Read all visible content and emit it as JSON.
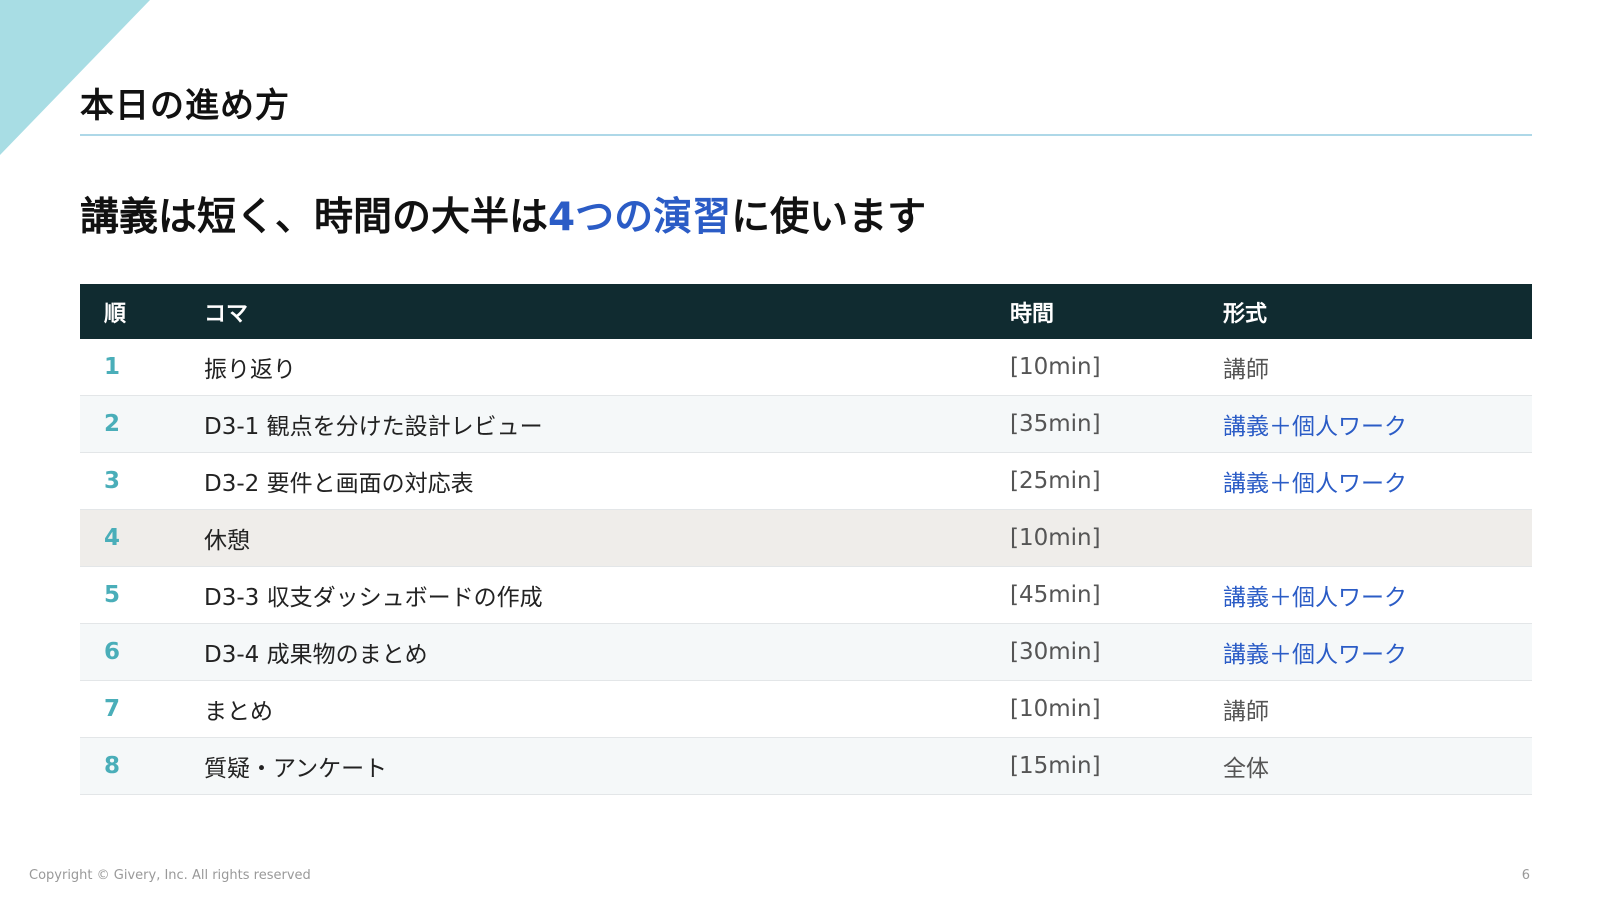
{
  "page": {
    "title": "本日の進め方",
    "headline_pre": "講義は短く、時間の大半は",
    "headline_highlight": "4つの演習",
    "headline_post": "に使います"
  },
  "table": {
    "headers": {
      "order": "順",
      "title": "コマ",
      "time": "時間",
      "format": "形式"
    },
    "rows": [
      {
        "order": "1",
        "title": "振り返り",
        "time": "[10min]",
        "format": "講師"
      },
      {
        "order": "2",
        "title": "D3-1 観点を分けた設計レビュー",
        "time": "[35min]",
        "format": "講義＋個人ワーク"
      },
      {
        "order": "3",
        "title": "D3-2 要件と画面の対応表",
        "time": "[25min]",
        "format": "講義＋個人ワーク"
      },
      {
        "order": "4",
        "title": "休憩",
        "time": "[10min]",
        "format": ""
      },
      {
        "order": "5",
        "title": "D3-3 収支ダッシュボードの作成",
        "time": "[45min]",
        "format": "講義＋個人ワーク"
      },
      {
        "order": "6",
        "title": "D3-4 成果物のまとめ",
        "time": "[30min]",
        "format": "講義＋個人ワーク"
      },
      {
        "order": "7",
        "title": "まとめ",
        "time": "[10min]",
        "format": "講師"
      },
      {
        "order": "8",
        "title": "質疑・アンケート",
        "time": "[15min]",
        "format": "全体"
      }
    ]
  },
  "footer": {
    "copyright": "Copyright © Givery, Inc. All rights reserved",
    "page_number": "6"
  },
  "colors": {
    "accent_blue": "#2b5cc6",
    "order_teal": "#4aaeb9",
    "header_bg": "#102b30",
    "corner": "#a8dde4",
    "break_row_bg": "#efedea"
  }
}
